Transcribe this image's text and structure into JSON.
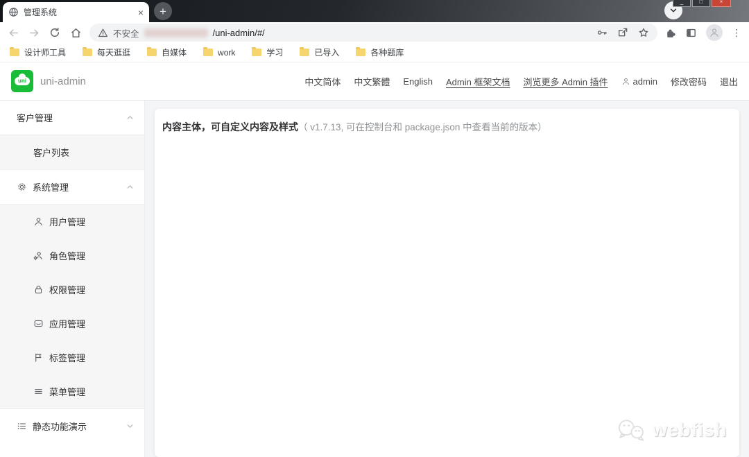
{
  "browser": {
    "tab_title": "管理系统",
    "new_tab_glyph": "+",
    "close_glyph": "×",
    "url": {
      "security_label": "不安全",
      "path": "/uni-admin/#/"
    },
    "bookmarks": [
      "设计师工具",
      "每天逛逛",
      "自媒体",
      "work",
      "学习",
      "已导入",
      "各种题库"
    ],
    "icons": [
      "globe-favicon",
      "back",
      "forward",
      "reload",
      "home",
      "warning-triangle",
      "key",
      "share",
      "star",
      "extensions-puzzle",
      "side-panel",
      "profile-avatar",
      "menu-dots"
    ]
  },
  "app_header": {
    "logo_text": "uni",
    "brand": "uni-admin",
    "lang_simplified": "中文简体",
    "lang_traditional": "中文繁體",
    "lang_english": "English",
    "docs_link": "Admin 框架文档",
    "plugins_link": "浏览更多 Admin 插件",
    "username": "admin",
    "change_password": "修改密码",
    "logout": "退出"
  },
  "sidebar": {
    "groups": [
      {
        "label": "客户管理",
        "icon": "none",
        "state": "expanded",
        "children": [
          {
            "label": "客户列表",
            "icon": "none"
          }
        ]
      },
      {
        "label": "系统管理",
        "icon": "gear",
        "state": "expanded",
        "children": [
          {
            "label": "用户管理",
            "icon": "person"
          },
          {
            "label": "角色管理",
            "icon": "person-gear"
          },
          {
            "label": "权限管理",
            "icon": "lock"
          },
          {
            "label": "应用管理",
            "icon": "app-box"
          },
          {
            "label": "标签管理",
            "icon": "flag"
          },
          {
            "label": "菜单管理",
            "icon": "menu-lines"
          }
        ]
      },
      {
        "label": "静态功能演示",
        "icon": "list",
        "state": "collapsed",
        "children": []
      }
    ]
  },
  "main": {
    "content_title": "内容主体，可自定义内容及样式",
    "content_note": "（ v1.7.13, 可在控制台和 package.json 中查看当前的版本）"
  },
  "watermark": {
    "text": "webfish",
    "icon": "wechat-bubbles"
  },
  "colors": {
    "brand_green": "#18bc37",
    "folder_yellow": "#f7d56e",
    "close_red": "#c94535",
    "submenu_bg": "#f6f6f6",
    "main_bg": "#f4f5f7"
  }
}
